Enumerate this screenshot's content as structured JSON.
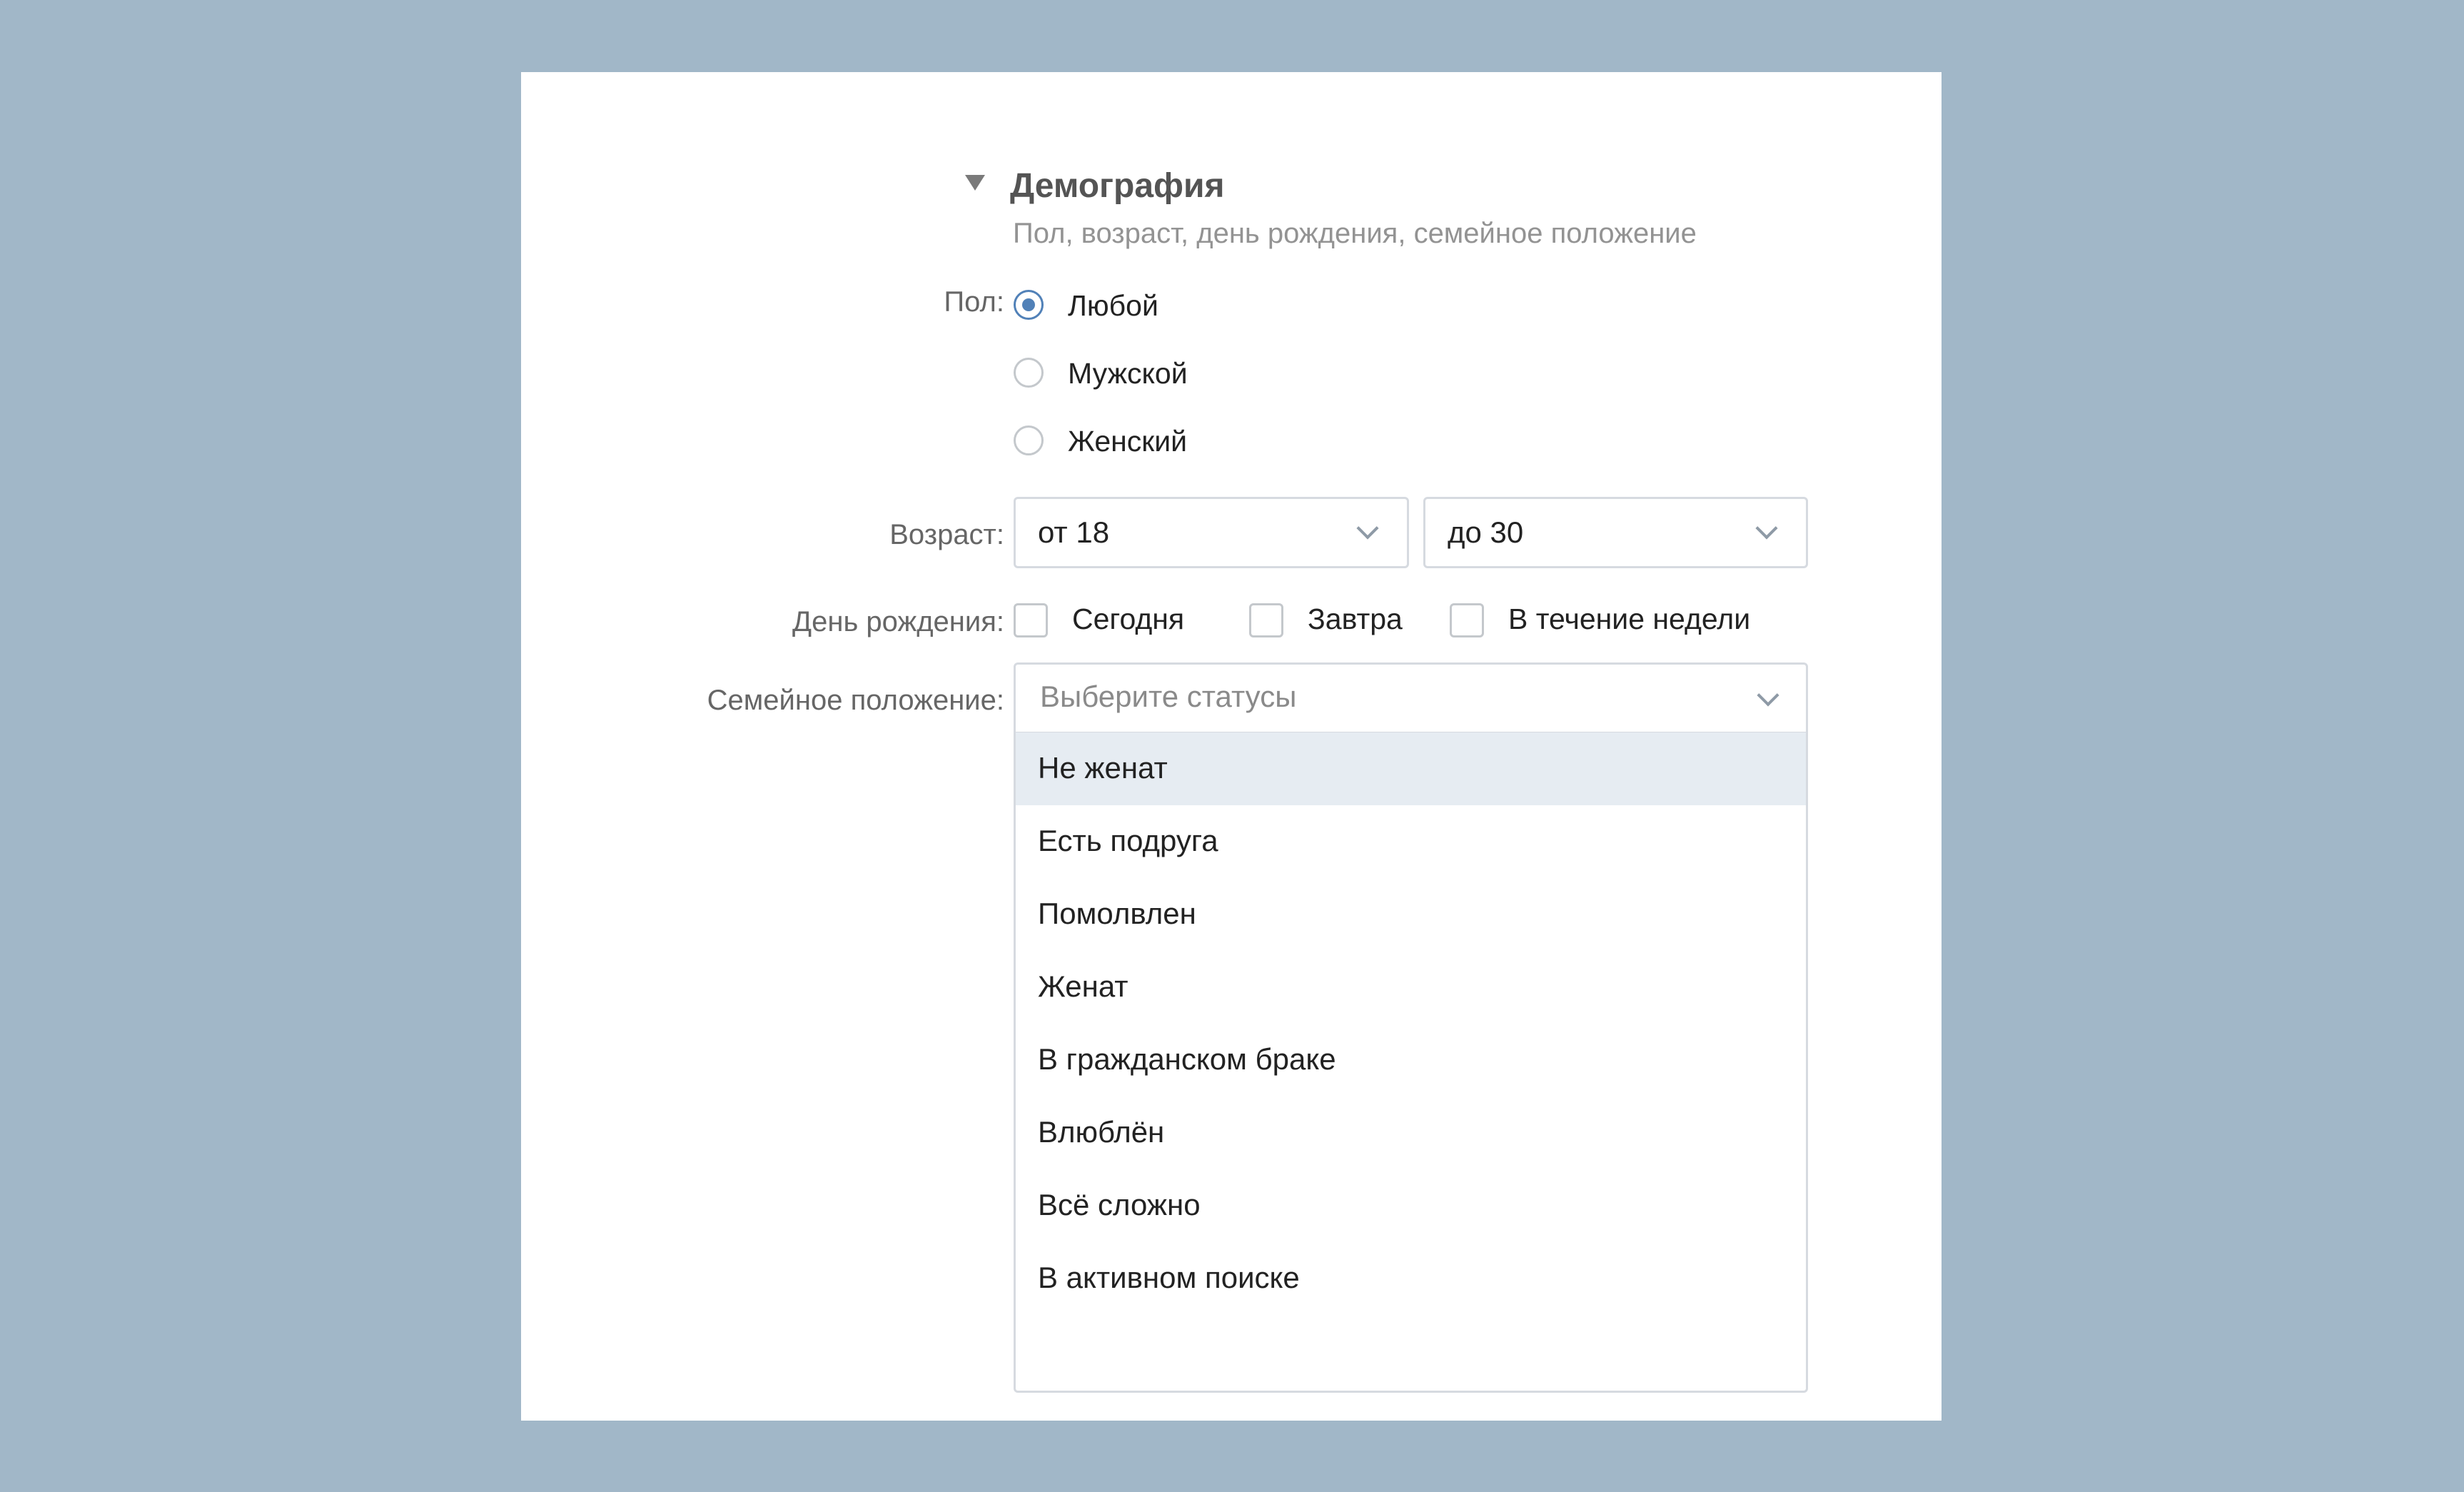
{
  "section": {
    "title": "Демография",
    "subtitle": "Пол, возраст, день рождения, семейное положение"
  },
  "gender": {
    "label": "Пол:",
    "options": [
      {
        "label": "Любой",
        "selected": true
      },
      {
        "label": "Мужской",
        "selected": false
      },
      {
        "label": "Женский",
        "selected": false
      }
    ]
  },
  "age": {
    "label": "Возраст:",
    "from": "от 18",
    "to": "до 30"
  },
  "birthday": {
    "label": "День рождения:",
    "options": [
      {
        "label": "Сегодня",
        "checked": false
      },
      {
        "label": "Завтра",
        "checked": false
      },
      {
        "label": "В течение недели",
        "checked": false
      }
    ]
  },
  "marital": {
    "label": "Семейное положение:",
    "placeholder": "Выберите статусы",
    "options": [
      "Не женат",
      "Есть подруга",
      "Помолвлен",
      "Женат",
      "В гражданском браке",
      "Влюблён",
      "Всё сложно",
      "В активном поиске"
    ],
    "highlighted_index": 0
  },
  "colors": {
    "background": "#a1b7c8",
    "panel": "#ffffff",
    "accent": "#5181b8",
    "hover": "#e6ecf2"
  }
}
